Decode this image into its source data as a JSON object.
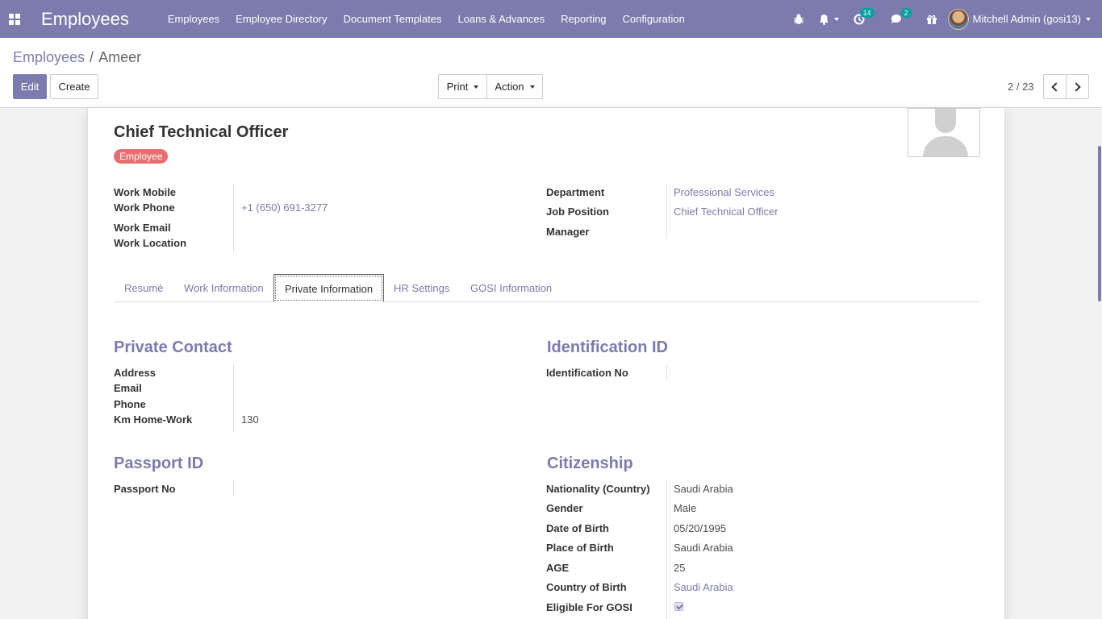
{
  "navbar": {
    "brand": "Employees",
    "menu": [
      "Employees",
      "Employee Directory",
      "Document Templates",
      "Loans & Advances",
      "Reporting",
      "Configuration"
    ],
    "activity_count": "14",
    "messages_count": "2",
    "user_name": "Mitchell Admin (gosi13)"
  },
  "control_panel": {
    "breadcrumb_parent": "Employees",
    "breadcrumb_sep": "/",
    "breadcrumb_current": "Ameer",
    "edit_label": "Edit",
    "create_label": "Create",
    "print_label": "Print",
    "action_label": "Action",
    "pager": "2 / 23"
  },
  "employee": {
    "job_title": "Chief Technical Officer",
    "tag": "Employee",
    "left_fields": [
      {
        "label": "Work Mobile",
        "value": ""
      },
      {
        "label": "Work Phone",
        "value": "+1 (650) 691-3277"
      },
      {
        "label": "Work Email",
        "value": ""
      },
      {
        "label": "Work Location",
        "value": ""
      }
    ],
    "right_fields": [
      {
        "label": "Department",
        "value": "Professional Services"
      },
      {
        "label": "Job Position",
        "value": "Chief Technical Officer"
      },
      {
        "label": "Manager",
        "value": ""
      }
    ]
  },
  "tabs": [
    "Resumé",
    "Work Information",
    "Private Information",
    "HR Settings",
    "GOSI Information"
  ],
  "active_tab": "Private Information",
  "private_contact": {
    "title": "Private Contact",
    "fields": [
      {
        "label": "Address",
        "value": ""
      },
      {
        "label": "Email",
        "value": ""
      },
      {
        "label": "Phone",
        "value": ""
      },
      {
        "label": "Km Home-Work",
        "value": "130"
      }
    ]
  },
  "identification": {
    "title": "Identification ID",
    "fields": [
      {
        "label": "Identification No",
        "value": ""
      }
    ]
  },
  "passport": {
    "title": "Passport ID",
    "fields": [
      {
        "label": "Passport No",
        "value": ""
      }
    ]
  },
  "citizenship": {
    "title": "Citizenship",
    "fields": [
      {
        "label": "Nationality (Country)",
        "value": "Saudi Arabia"
      },
      {
        "label": "Gender",
        "value": "Male"
      },
      {
        "label": "Date of Birth",
        "value": "05/20/1995"
      },
      {
        "label": "Place of Birth",
        "value": "Saudi Arabia"
      },
      {
        "label": "AGE",
        "value": "25"
      },
      {
        "label": "Country of Birth",
        "value": "Saudi Arabia"
      },
      {
        "label": "Eligible For GOSI",
        "value": ""
      }
    ]
  },
  "colors": {
    "brand": "#7c7bad",
    "tag": "#e86f6f",
    "badge": "#00a09d"
  }
}
